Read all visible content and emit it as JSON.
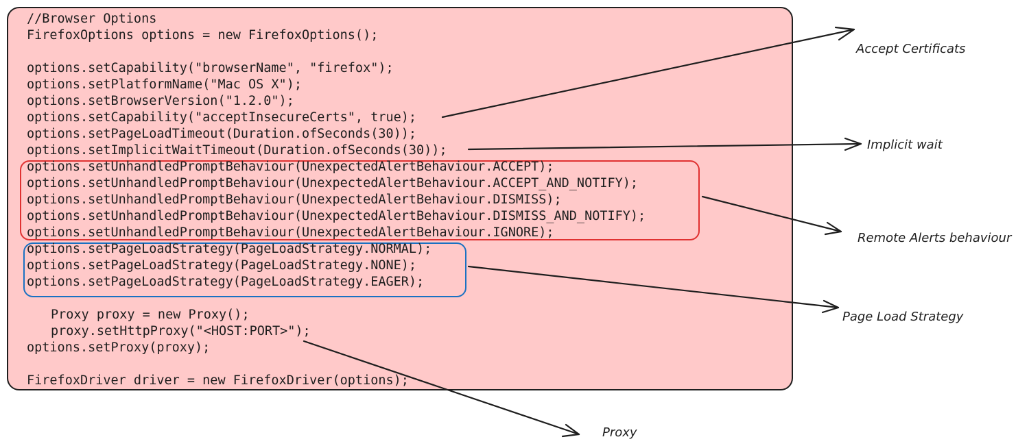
{
  "code": {
    "lines": [
      "//Browser Options",
      "FirefoxOptions options = new FirefoxOptions();",
      "",
      "options.setCapability(\"browserName\", \"firefox\");",
      "options.setPlatformName(\"Mac OS X\");",
      "options.setBrowserVersion(\"1.2.0\");",
      "options.setCapability(\"acceptInsecureCerts\", true);",
      "options.setPageLoadTimeout(Duration.ofSeconds(30));",
      "options.setImplicitWaitTimeout(Duration.ofSeconds(30));",
      "options.setUnhandledPromptBehaviour(UnexpectedAlertBehaviour.ACCEPT);",
      "options.setUnhandledPromptBehaviour(UnexpectedAlertBehaviour.ACCEPT_AND_NOTIFY);",
      "options.setUnhandledPromptBehaviour(UnexpectedAlertBehaviour.DISMISS);",
      "options.setUnhandledPromptBehaviour(UnexpectedAlertBehaviour.DISMISS_AND_NOTIFY);",
      "options.setUnhandledPromptBehaviour(UnexpectedAlertBehaviour.IGNORE);",
      "options.setPageLoadStrategy(PageLoadStrategy.NORMAL);",
      "options.setPageLoadStrategy(PageLoadStrategy.NONE);",
      "options.setPageLoadStrategy(PageLoadStrategy.EAGER);",
      "",
      "Proxy proxy = new Proxy();",
      "proxy.setHttpProxy(\"<HOST:PORT>\");",
      "options.setProxy(proxy);",
      "",
      "FirefoxDriver driver = new FirefoxDriver(options);"
    ]
  },
  "annotations": {
    "accept_certs": "Accept Certificats",
    "implicit_wait": "Implicit wait",
    "remote_alerts": "Remote Alerts behaviour",
    "page_load": "Page Load Strategy",
    "proxy": "Proxy"
  },
  "colors": {
    "panel_fill": "#ffc9c9",
    "panel_stroke": "#1e1e1e",
    "alerts_box": "#e03131",
    "strategy_box": "#1971c2",
    "text": "#1e1e1e"
  }
}
